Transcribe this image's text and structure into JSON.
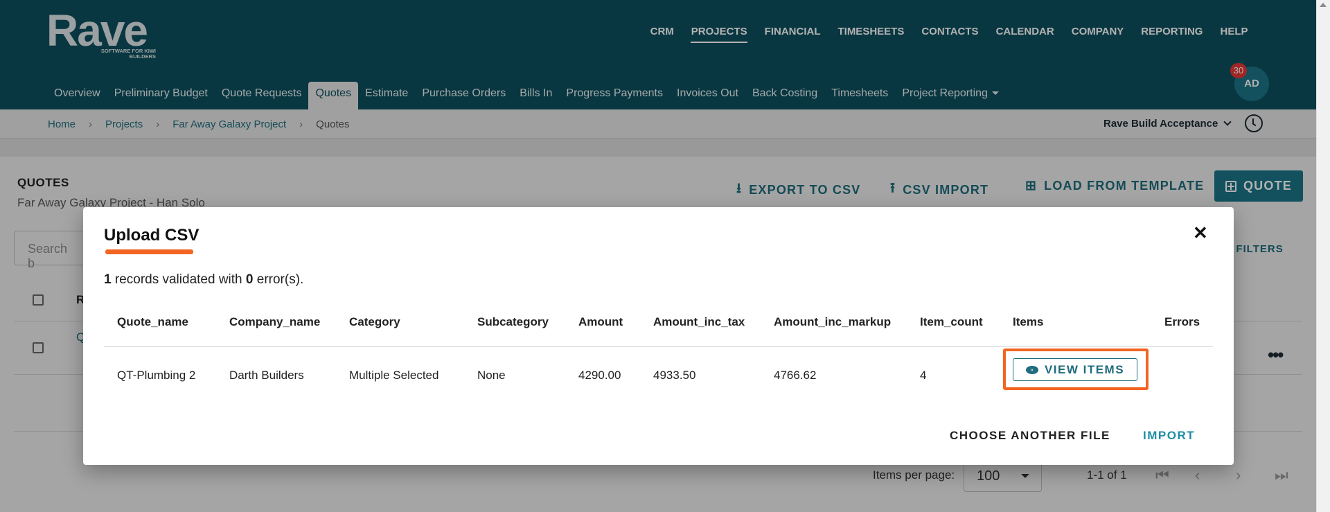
{
  "app": {
    "logo_word": "Rave",
    "logo_tagline": "SOFTWARE FOR KIWI BUILDERS"
  },
  "topnav": [
    "CRM",
    "PROJECTS",
    "FINANCIAL",
    "TIMESHEETS",
    "CONTACTS",
    "CALENDAR",
    "COMPANY",
    "REPORTING",
    "HELP"
  ],
  "topnav_active": "PROJECTS",
  "subnav": [
    "Overview",
    "Preliminary Budget",
    "Quote Requests",
    "Quotes",
    "Estimate",
    "Purchase Orders",
    "Bills In",
    "Progress Payments",
    "Invoices Out",
    "Back Costing",
    "Timesheets",
    "Project Reporting"
  ],
  "subnav_active": "Quotes",
  "user": {
    "initials": "AD",
    "notifications": "30"
  },
  "breadcrumb": [
    "Home",
    "Projects",
    "Far Away Galaxy Project",
    "Quotes"
  ],
  "environment": "Rave Build Acceptance",
  "page": {
    "title": "QUOTES",
    "subtitle": "Far Away Galaxy Project - Han Solo",
    "actions": {
      "export": "EXPORT TO CSV",
      "import": "CSV IMPORT",
      "template": "LOAD FROM TEMPLATE",
      "quote": "QUOTE"
    },
    "search_placeholder": "Search b",
    "reset_filters": "ET FILTERS",
    "col_first_partial": "R",
    "row_first_partial": "Q",
    "items_per_page_label": "Items per page:",
    "items_per_page": "100",
    "range": "1-1 of 1"
  },
  "modal": {
    "title": "Upload CSV",
    "summary_count": "1",
    "summary_mid": " records validated with ",
    "summary_errors": "0",
    "summary_end": " error(s).",
    "columns": [
      "Quote_name",
      "Company_name",
      "Category",
      "Subcategory",
      "Amount",
      "Amount_inc_tax",
      "Amount_inc_markup",
      "Item_count",
      "Items",
      "Errors"
    ],
    "row": {
      "quote_name": "QT-Plumbing 2",
      "company_name": "Darth Builders",
      "category": "Multiple Selected",
      "subcategory": "None",
      "amount": "4290.00",
      "amount_inc_tax": "4933.50",
      "amount_inc_markup": "4766.62",
      "item_count": "4"
    },
    "view_items_label": "VIEW ITEMS",
    "choose_another": "CHOOSE ANOTHER FILE",
    "import_label": "IMPORT",
    "close_glyph": "✕"
  },
  "colors": {
    "header": "#0d4f5e",
    "accent": "#1e6c7c",
    "highlight": "#f26522",
    "badge": "#e53935"
  }
}
